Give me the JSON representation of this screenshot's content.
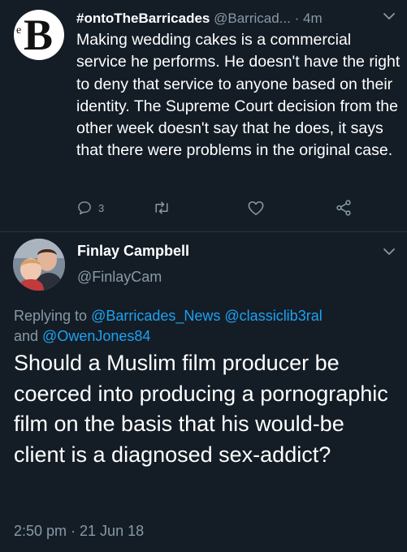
{
  "tweet1": {
    "avatar_letter": "B",
    "avatar_small": "e",
    "name": "#ontoTheBarricades",
    "handle": "@Barricad...",
    "separator": "·",
    "time": "4m",
    "body": "Making wedding cakes is a commercial service he performs. He doesn't have the right to deny that service to anyone based on their identity. The Supreme Court decision from the other week doesn't say that he does, it says that there were problems in the original case.",
    "reply_count": "3",
    "icons": [
      "reply-icon",
      "retweet-icon",
      "like-icon",
      "share-icon"
    ]
  },
  "tweet2": {
    "name": "Finlay Campbell",
    "handle": "@FinlayCam",
    "replying_prefix": "Replying to ",
    "mention1": "@Barricades_News",
    "mention2": "@classiclib3ral",
    "and_text": "and ",
    "mention3": "@OwenJones84",
    "body": "Should a Muslim film producer be coerced into producing a pornographic film on the basis that his would-be client is a diagnosed sex-addict?",
    "date": "2:50 pm · 21 Jun 18"
  },
  "colors": {
    "background": "#141d26",
    "muted": "#8899a6",
    "link": "#1da1f2",
    "divider": "#243447"
  }
}
